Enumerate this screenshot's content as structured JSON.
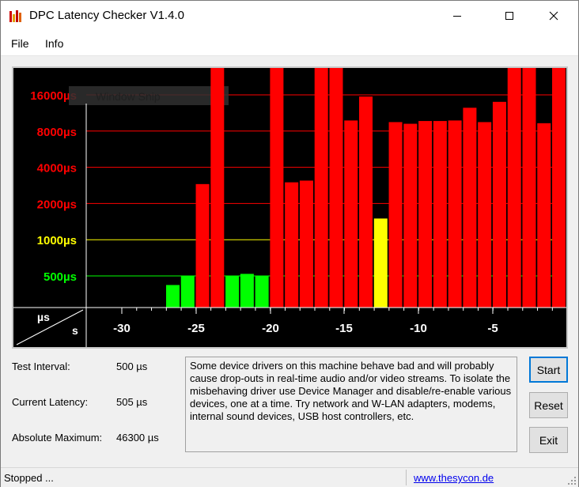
{
  "window": {
    "title": "DPC Latency Checker V1.4.0"
  },
  "menu": {
    "items": [
      "File",
      "Info"
    ]
  },
  "colors": {
    "red": "#ff0000",
    "yellow": "#ffff00",
    "green": "#00ff00",
    "tick_red": "#ff0000",
    "tick_yellow": "#ffff00",
    "tick_green": "#00ff00"
  },
  "chart_data": {
    "type": "bar",
    "title": "",
    "y_scale": "log",
    "y_ticks": [
      {
        "label": "16000µs",
        "value": 16000,
        "color": "red"
      },
      {
        "label": "8000µs",
        "value": 8000,
        "color": "red"
      },
      {
        "label": "4000µs",
        "value": 4000,
        "color": "red"
      },
      {
        "label": "2000µs",
        "value": 2000,
        "color": "red"
      },
      {
        "label": "1000µs",
        "value": 1000,
        "color": "yellow"
      },
      {
        "label": "500µs",
        "value": 500,
        "color": "green"
      }
    ],
    "x_ticks": [
      "-30",
      "-25",
      "-20",
      "-15",
      "-10",
      "-5"
    ],
    "corner_labels": {
      "y_unit": "µs",
      "x_unit": "s"
    },
    "overlay_text": "Window Snip",
    "x": [
      -26,
      -25,
      -24,
      -23,
      -22,
      -21,
      -20,
      -19,
      -18,
      -17,
      -16,
      -15,
      -14,
      -13,
      -12,
      -11,
      -10,
      -9,
      -8,
      -7,
      -6,
      -5,
      -4,
      -3,
      -2,
      -1
    ],
    "values": [
      420,
      500,
      2900,
      16000,
      500,
      520,
      500,
      46300,
      3000,
      3100,
      46300,
      46300,
      9800,
      15500,
      1500,
      9500,
      9200,
      9700,
      9700,
      9800,
      12500,
      9500,
      14000,
      46300,
      16000,
      9300,
      16500
    ],
    "bar_colors_by_threshold": {
      "green_below": 1000,
      "yellow_below": 2000
    }
  },
  "stats": {
    "test_interval_label": "Test Interval:",
    "test_interval_value": "500 µs",
    "current_latency_label": "Current Latency:",
    "current_latency_value": "505 µs",
    "absolute_maximum_label": "Absolute Maximum:",
    "absolute_maximum_value": "46300 µs"
  },
  "description": "Some device drivers on this machine behave bad and will probably cause drop-outs in real-time audio and/or video streams. To isolate the misbehaving driver use Device Manager and disable/re-enable various devices, one at a time. Try network and W-LAN adapters, modems, internal sound devices, USB host controllers, etc.",
  "buttons": {
    "start": "Start",
    "reset": "Reset",
    "exit": "Exit"
  },
  "status": {
    "text": "Stopped ...",
    "link": "www.thesycon.de"
  }
}
